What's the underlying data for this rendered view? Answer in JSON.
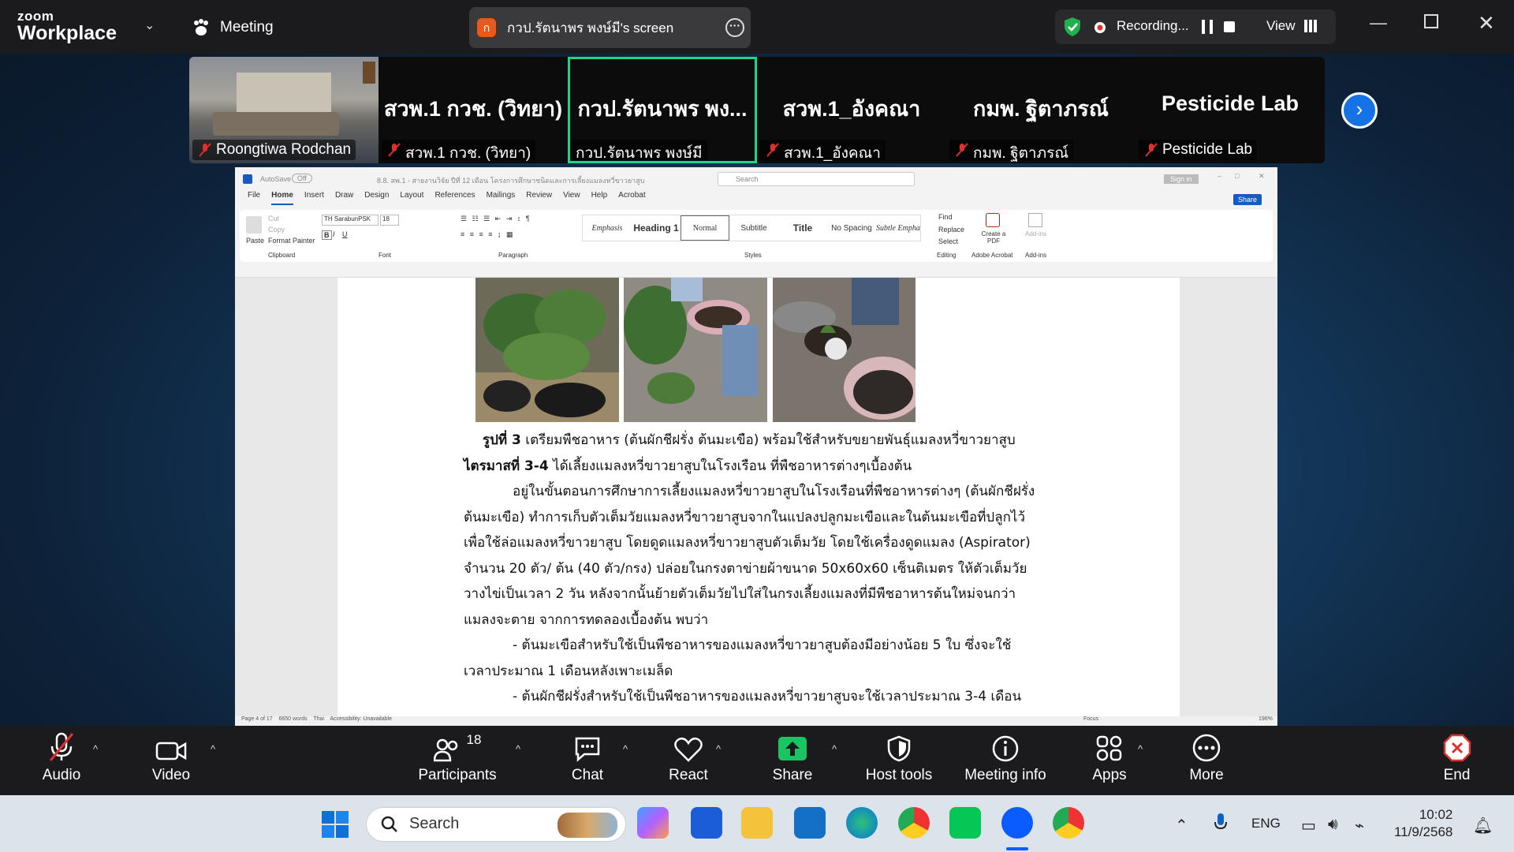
{
  "topbar": {
    "logo_top": "zoom",
    "logo_bottom": "Workplace",
    "meeting_label": "Meeting",
    "share_avatar_letter": "ก",
    "share_title": "กวป.รัตนาพร พงษ์มี's screen",
    "recording_label": "Recording...",
    "view_label": "View"
  },
  "participants": {
    "tiles": [
      {
        "big": "",
        "name": "Roongtiwa Rodchan"
      },
      {
        "big": "สวพ.1 กวช. (วิทยา)",
        "name": "สวพ.1 กวช. (วิทยา)"
      },
      {
        "big": "กวป.รัตนาพร พง...",
        "name": "กวป.รัตนาพร พงษ์มี"
      },
      {
        "big": "สวพ.1_อังคณา",
        "name": "สวพ.1_อังคณา"
      },
      {
        "big": "กมพ. ฐิตาภรณ์",
        "name": "กมพ. ฐิตาภรณ์"
      },
      {
        "big": "Pesticide Lab",
        "name": "Pesticide Lab"
      }
    ]
  },
  "word": {
    "title_text": "8.8. สพ.1 - สายงานวิจัย ปีที่ 12 เดือน โครงการศึกษาชนิดและการเลี้ยงแมลงหวี่ขาวยาสูบ - Compatibility Mode • Saved",
    "autosave": "AutoSave",
    "autosave_state": "Off",
    "search_placeholder": "Search",
    "signin": "Sign in",
    "share": "Share",
    "menu": [
      "File",
      "Home",
      "Insert",
      "Draw",
      "Design",
      "Layout",
      "References",
      "Mailings",
      "Review",
      "View",
      "Help",
      "Acrobat"
    ],
    "clipboard": {
      "paste": "Paste",
      "cut": "Cut",
      "copy": "Copy",
      "format_painter": "Format Painter",
      "group": "Clipboard"
    },
    "font": {
      "name": "TH SarabunPSK",
      "size": "18",
      "group": "Font"
    },
    "paragraph_group": "Paragraph",
    "styles": [
      "Emphasis",
      "Heading 1",
      "Normal",
      "Subtitle",
      "Title",
      "No Spacing",
      "Subtle Emphasi"
    ],
    "styles_group": "Styles",
    "editing": {
      "find": "Find",
      "replace": "Replace",
      "select": "Select",
      "group": "Editing"
    },
    "acrobat": {
      "create": "Create a PDF",
      "group": "Adobe Acrobat"
    },
    "addins": {
      "label": "Add-ins",
      "group": "Add-ins"
    },
    "status": {
      "page": "Page 4 of 17",
      "words": "6650 words",
      "lang": "Thai",
      "access": "Accessibility: Unavailable",
      "focus": "Focus",
      "zoom": "196%"
    }
  },
  "document": {
    "lines": [
      {
        "bold": "รูปที่ 3",
        "text": " เตรียมพืชอาหาร (ต้นผักชีฝรั่ง ต้นมะเขือ) พร้อมใช้สำหรับขยายพันธุ์แมลงหวี่ขาวยาสูบ"
      },
      {
        "bold": "ไตรมาสที่ 3-4",
        "text": " ได้เลี้ยงแมลงหวี่ขาวยาสูบในโรงเรือน ที่พืชอาหารต่างๆเบื้องต้น"
      },
      {
        "bold": "",
        "text": "อยู่ในขั้นตอนการศึกษาการเลี้ยงแมลงหวี่ขาวยาสูบในโรงเรือนที่พืชอาหารต่างๆ (ต้นผักชีฝรั่ง"
      },
      {
        "bold": "",
        "text": "ต้นมะเขือ) ทำการเก็บตัวเต็มวัยแมลงหวี่ขาวยาสูบจากในแปลงปลูกมะเขือและในต้นมะเขือที่ปลูกไว้"
      },
      {
        "bold": "",
        "text": "เพื่อใช้ล่อแมลงหวี่ขาวยาสูบ โดยดูดแมลงหวี่ขาวยาสูบตัวเต็มวัย โดยใช้เครื่องดูดแมลง (Aspirator)"
      },
      {
        "bold": "",
        "text": "จำนวน 20 ตัว/ ต้น (40 ตัว/กรง) ปล่อยในกรงตาข่ายผ้าขนาด 50x60x60 เซ็นติเมตร ให้ตัวเต็มวัย"
      },
      {
        "bold": "",
        "text": "วางไข่เป็นเวลา 2 วัน หลังจากนั้นย้ายตัวเต็มวัยไปใส่ในกรงเลี้ยงแมลงที่มีพืชอาหารต้นใหม่จนกว่า"
      },
      {
        "bold": "",
        "text": "แมลงจะตาย จากการทดลองเบื้องต้น พบว่า"
      },
      {
        "bold": "",
        "text": "- ต้นมะเขือสำหรับใช้เป็นพืชอาหารของแมลงหวี่ขาวยาสูบต้องมีอย่างน้อย 5 ใบ ซึ่งจะใช้"
      },
      {
        "bold": "",
        "text": "เวลาประมาณ 1 เดือนหลังเพาะเมล็ด"
      },
      {
        "bold": "",
        "text": "- ต้นผักชีฝรั่งสำหรับใช้เป็นพืชอาหารของแมลงหวี่ขาวยาสูบจะใช้เวลาประมาณ 3-4 เดือน"
      }
    ]
  },
  "toolbar": {
    "audio": "Audio",
    "video": "Video",
    "participants": "Participants",
    "participants_count": "18",
    "chat": "Chat",
    "react": "React",
    "share": "Share",
    "host_tools": "Host tools",
    "meeting_info": "Meeting info",
    "apps": "Apps",
    "more": "More",
    "end": "End"
  },
  "taskbar": {
    "search": "Search",
    "lang": "ENG",
    "time": "10:02",
    "date": "11/9/2568"
  }
}
